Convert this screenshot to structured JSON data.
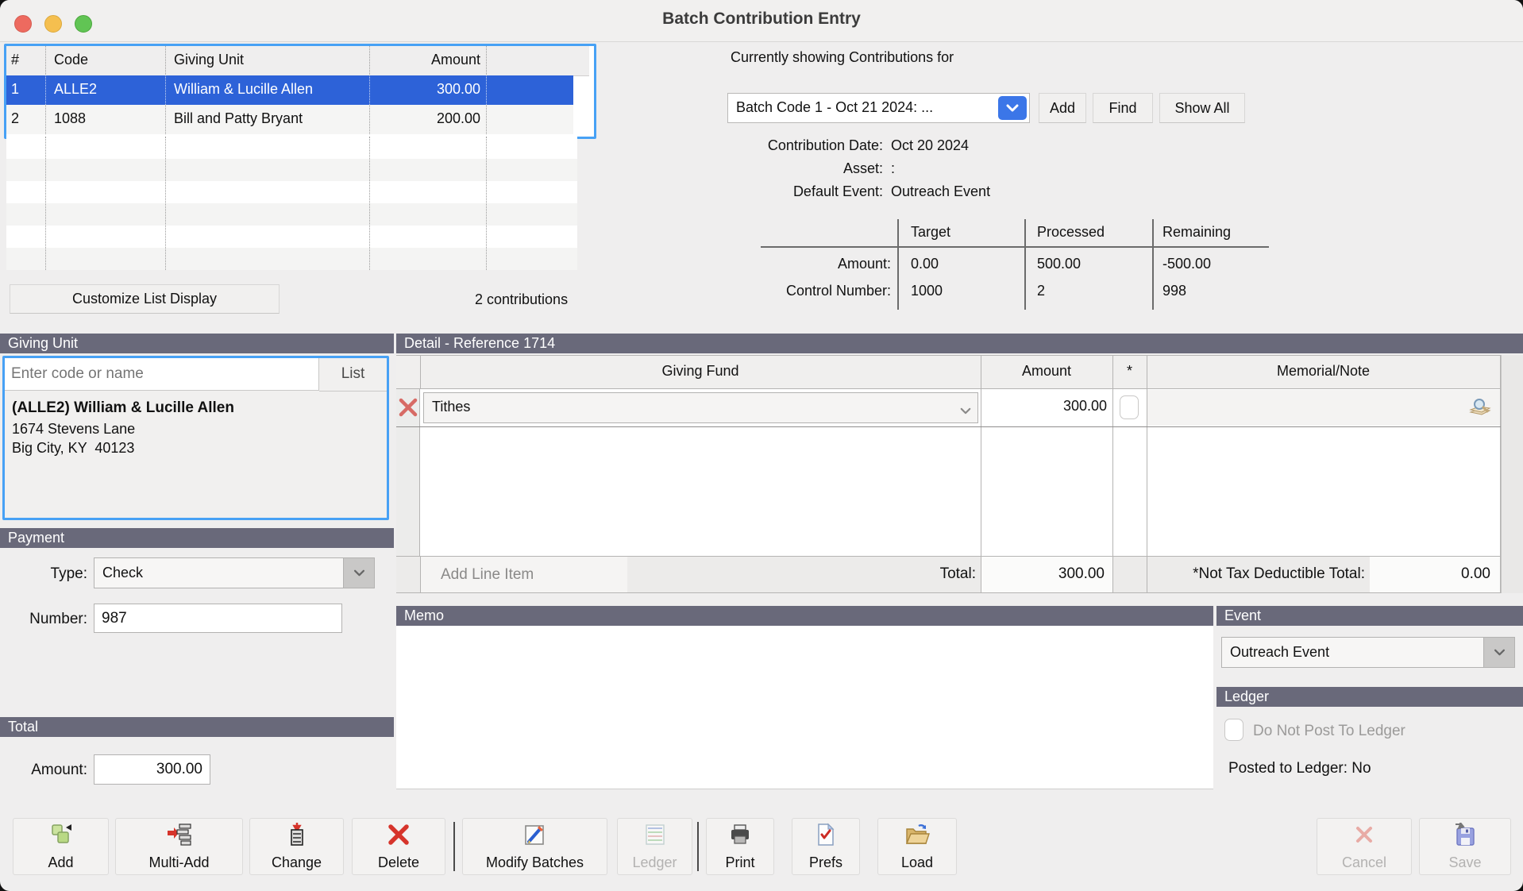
{
  "window": {
    "title": "Batch Contribution Entry"
  },
  "colors": {
    "selection_blue": "#2d62d8",
    "focus_ring_blue": "#47a1f5",
    "section_bar_gray": "#69697a",
    "accent_button_blue": "#3b76e8",
    "delete_red": "#d6423a"
  },
  "list": {
    "columns": {
      "num": "#",
      "code": "Code",
      "unit": "Giving Unit",
      "amount": "Amount"
    },
    "rows": [
      {
        "num": "1",
        "code": "ALLE2",
        "unit": "William & Lucille Allen",
        "amount": "300.00"
      },
      {
        "num": "2",
        "code": "1088",
        "unit": "Bill and Patty Bryant",
        "amount": "200.00"
      }
    ],
    "customize_button": "Customize List Display",
    "count": "2 contributions"
  },
  "batch": {
    "heading": "Currently showing Contributions for",
    "selected_batch": "Batch Code 1 - Oct 21 2024: ...",
    "add": "Add",
    "find": "Find",
    "show_all": "Show All",
    "contribution_date_label": "Contribution Date:",
    "contribution_date": "Oct 20 2024",
    "asset_label": "Asset:",
    "asset_value": ":",
    "default_event_label": "Default Event:",
    "default_event": "Outreach Event",
    "stats": {
      "col_target": "Target",
      "col_processed": "Processed",
      "col_remaining": "Remaining",
      "amount_label": "Amount:",
      "amount_target": "0.00",
      "amount_processed": "500.00",
      "amount_remaining": "-500.00",
      "control_label": "Control Number:",
      "control_target": "1000",
      "control_processed": "2",
      "control_remaining": "998"
    }
  },
  "giving_unit": {
    "header": "Giving Unit",
    "placeholder": "Enter code or name",
    "list_button": "List",
    "name": "(ALLE2) William & Lucille Allen",
    "address1": "1674 Stevens Lane",
    "address2": "Big City, KY  40123"
  },
  "payment": {
    "header": "Payment",
    "type_label": "Type:",
    "type_value": "Check",
    "number_label": "Number:",
    "number_value": "987"
  },
  "total": {
    "header": "Total",
    "amount_label": "Amount:",
    "amount_value": "300.00"
  },
  "detail": {
    "header": "Detail - Reference 1714",
    "col_fund": "Giving Fund",
    "col_amount": "Amount",
    "col_star": "*",
    "col_memo": "Memorial/Note",
    "row": {
      "fund": "Tithes",
      "amount": "300.00"
    },
    "add_line_item": "Add Line Item",
    "total_label": "Total:",
    "total_value": "300.00",
    "ntd_label": "*Not Tax Deductible Total:",
    "ntd_value": "0.00"
  },
  "memo": {
    "header": "Memo"
  },
  "event": {
    "header": "Event",
    "value": "Outreach Event"
  },
  "ledger": {
    "header": "Ledger",
    "checkbox_label": "Do Not Post To Ledger",
    "posted": "Posted to Ledger: No"
  },
  "toolbar": {
    "add": "Add",
    "multi_add": "Multi-Add",
    "change": "Change",
    "delete": "Delete",
    "modify_batches": "Modify Batches",
    "ledger": "Ledger",
    "print": "Print",
    "prefs": "Prefs",
    "load": "Load",
    "cancel": "Cancel",
    "save": "Save"
  }
}
